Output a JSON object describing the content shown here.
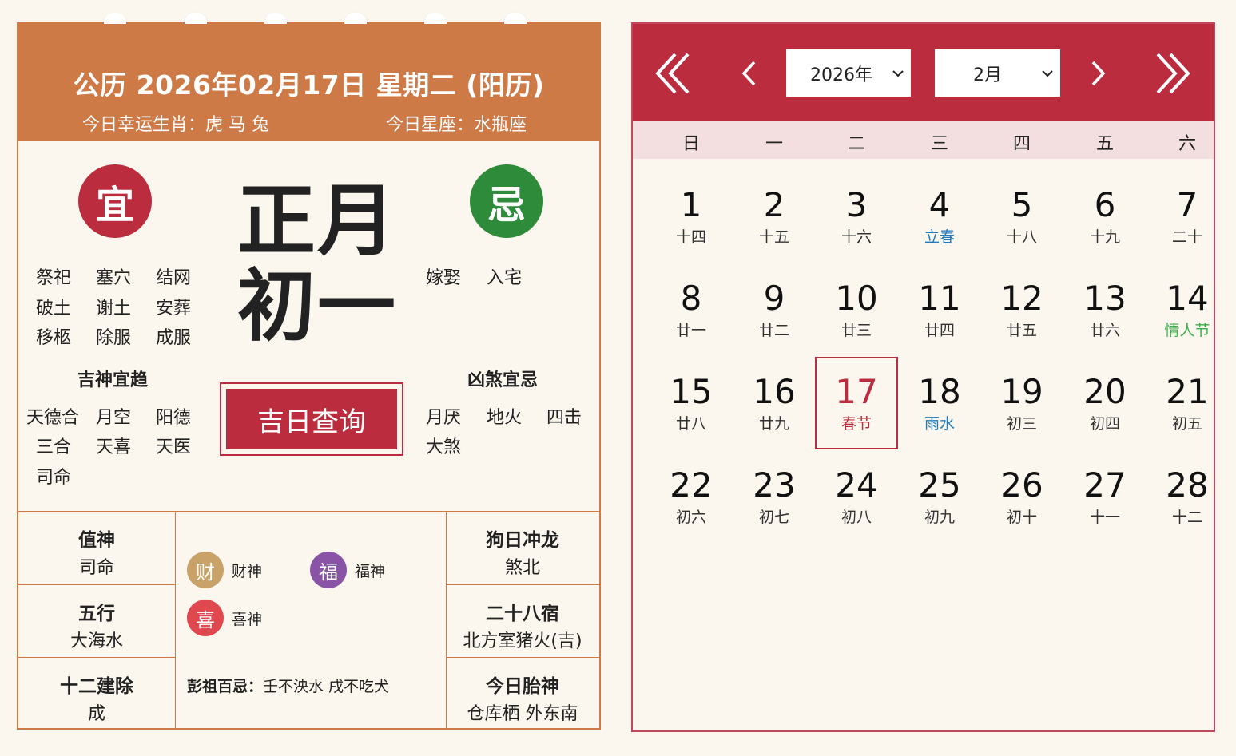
{
  "left": {
    "header": {
      "title": "公历 2026年02月17日 星期二 (阳历)",
      "lucky_zodiac": "今日幸运生肖：虎 马 兔",
      "constellation": "今日星座：水瓶座"
    },
    "yi": {
      "label": "宜",
      "items": [
        "祭祀",
        "塞穴",
        "结网",
        "破土",
        "谢土",
        "安葬",
        "移柩",
        "除服",
        "成服"
      ]
    },
    "ji": {
      "label": "忌",
      "items": [
        "嫁娶",
        "入宅"
      ]
    },
    "lunar": {
      "month": "正月",
      "day": "初一"
    },
    "auspicious": {
      "title": "吉神宜趋",
      "items": [
        "天德合",
        "月空",
        "阳德",
        "三合",
        "天喜",
        "天医",
        "司命"
      ]
    },
    "inauspicious": {
      "title": "凶煞宜忌",
      "items": [
        "月厌",
        "地火",
        "四击",
        "大煞"
      ]
    },
    "query_button": "吉日查询",
    "info": {
      "zhishen": {
        "title": "值神",
        "value": "司命"
      },
      "wuxing": {
        "title": "五行",
        "value": "大海水"
      },
      "jianchu": {
        "title": "十二建除",
        "value": "成"
      },
      "chong": {
        "title": "狗日冲龙",
        "value": "煞北"
      },
      "xiu": {
        "title": "二十八宿",
        "value": "北方室猪火(吉)"
      },
      "taishen": {
        "title": "今日胎神",
        "value": "仓库栖 外东南"
      }
    },
    "gods": [
      {
        "icon": "财",
        "label": "财神",
        "color": "#c9a26a"
      },
      {
        "icon": "福",
        "label": "福神",
        "color": "#8a54a6"
      },
      {
        "icon": "喜",
        "label": "喜神",
        "color": "#e0484f"
      }
    ],
    "pengzu": {
      "label": "彭祖百忌：",
      "value": "壬不泱水 戌不吃犬"
    }
  },
  "calendar": {
    "year_select": "2026年",
    "month_select": "2月",
    "weekdays": [
      "日",
      "一",
      "二",
      "三",
      "四",
      "五",
      "六"
    ],
    "days": [
      {
        "d": "1",
        "l": "十四"
      },
      {
        "d": "2",
        "l": "十五"
      },
      {
        "d": "3",
        "l": "十六"
      },
      {
        "d": "4",
        "l": "立春",
        "t": "term"
      },
      {
        "d": "5",
        "l": "十八"
      },
      {
        "d": "6",
        "l": "十九"
      },
      {
        "d": "7",
        "l": "二十"
      },
      {
        "d": "8",
        "l": "廿一"
      },
      {
        "d": "9",
        "l": "廿二"
      },
      {
        "d": "10",
        "l": "廿三"
      },
      {
        "d": "11",
        "l": "廿四"
      },
      {
        "d": "12",
        "l": "廿五"
      },
      {
        "d": "13",
        "l": "廿六"
      },
      {
        "d": "14",
        "l": "情人节",
        "t": "fest-green"
      },
      {
        "d": "15",
        "l": "廿八"
      },
      {
        "d": "16",
        "l": "廿九"
      },
      {
        "d": "17",
        "l": "春节",
        "t": "selected"
      },
      {
        "d": "18",
        "l": "雨水",
        "t": "term"
      },
      {
        "d": "19",
        "l": "初三"
      },
      {
        "d": "20",
        "l": "初四"
      },
      {
        "d": "21",
        "l": "初五"
      },
      {
        "d": "22",
        "l": "初六"
      },
      {
        "d": "23",
        "l": "初七"
      },
      {
        "d": "24",
        "l": "初八"
      },
      {
        "d": "25",
        "l": "初九"
      },
      {
        "d": "26",
        "l": "初十"
      },
      {
        "d": "27",
        "l": "十一"
      },
      {
        "d": "28",
        "l": "十二"
      }
    ],
    "colors": {
      "header": "#bb2d3e",
      "weekday_bg": "#f3dfdf",
      "term": "#1f7bbd",
      "festival": "#3fae49"
    }
  }
}
